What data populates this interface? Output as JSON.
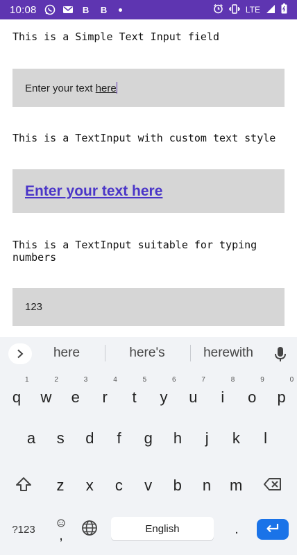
{
  "status_bar": {
    "time": "10:08",
    "lte": "LTE"
  },
  "labels": {
    "simple": "This is a Simple Text Input field",
    "custom": "This is a TextInput with custom text style",
    "numbers": "This is a TextInput suitable for typing numbers"
  },
  "fields": {
    "simple": {
      "before": "Enter your text ",
      "underlined": "here"
    },
    "custom": {
      "value": "Enter your text here"
    },
    "numbers": {
      "value": "123"
    }
  },
  "keyboard": {
    "suggestions": [
      "here",
      "here's",
      "herewith"
    ],
    "row1": [
      {
        "num": "1",
        "ch": "q"
      },
      {
        "num": "2",
        "ch": "w"
      },
      {
        "num": "3",
        "ch": "e"
      },
      {
        "num": "4",
        "ch": "r"
      },
      {
        "num": "5",
        "ch": "t"
      },
      {
        "num": "6",
        "ch": "y"
      },
      {
        "num": "7",
        "ch": "u"
      },
      {
        "num": "8",
        "ch": "i"
      },
      {
        "num": "9",
        "ch": "o"
      },
      {
        "num": "0",
        "ch": "p"
      }
    ],
    "row2": [
      "a",
      "s",
      "d",
      "f",
      "g",
      "h",
      "j",
      "k",
      "l"
    ],
    "row3": [
      "z",
      "x",
      "c",
      "v",
      "b",
      "n",
      "m"
    ],
    "symbols_label": "?123",
    "comma": ",",
    "space_label": "English",
    "period": "."
  },
  "icons": {
    "status": [
      "whatsapp-icon",
      "gmail-icon",
      "b-icon",
      "b-icon",
      "dot-icon",
      "alarm-icon",
      "vibrate-icon",
      "signal-icon",
      "battery-icon"
    ],
    "keyboard": [
      "chevron-right-icon",
      "microphone-icon",
      "shift-icon",
      "backspace-icon",
      "emoji-icon",
      "globe-icon",
      "enter-icon"
    ]
  },
  "colors": {
    "status_bar": "#5e35b1",
    "field_bg": "#d6d6d6",
    "custom_text": "#4a35c8",
    "enter_key": "#1a73e8"
  }
}
